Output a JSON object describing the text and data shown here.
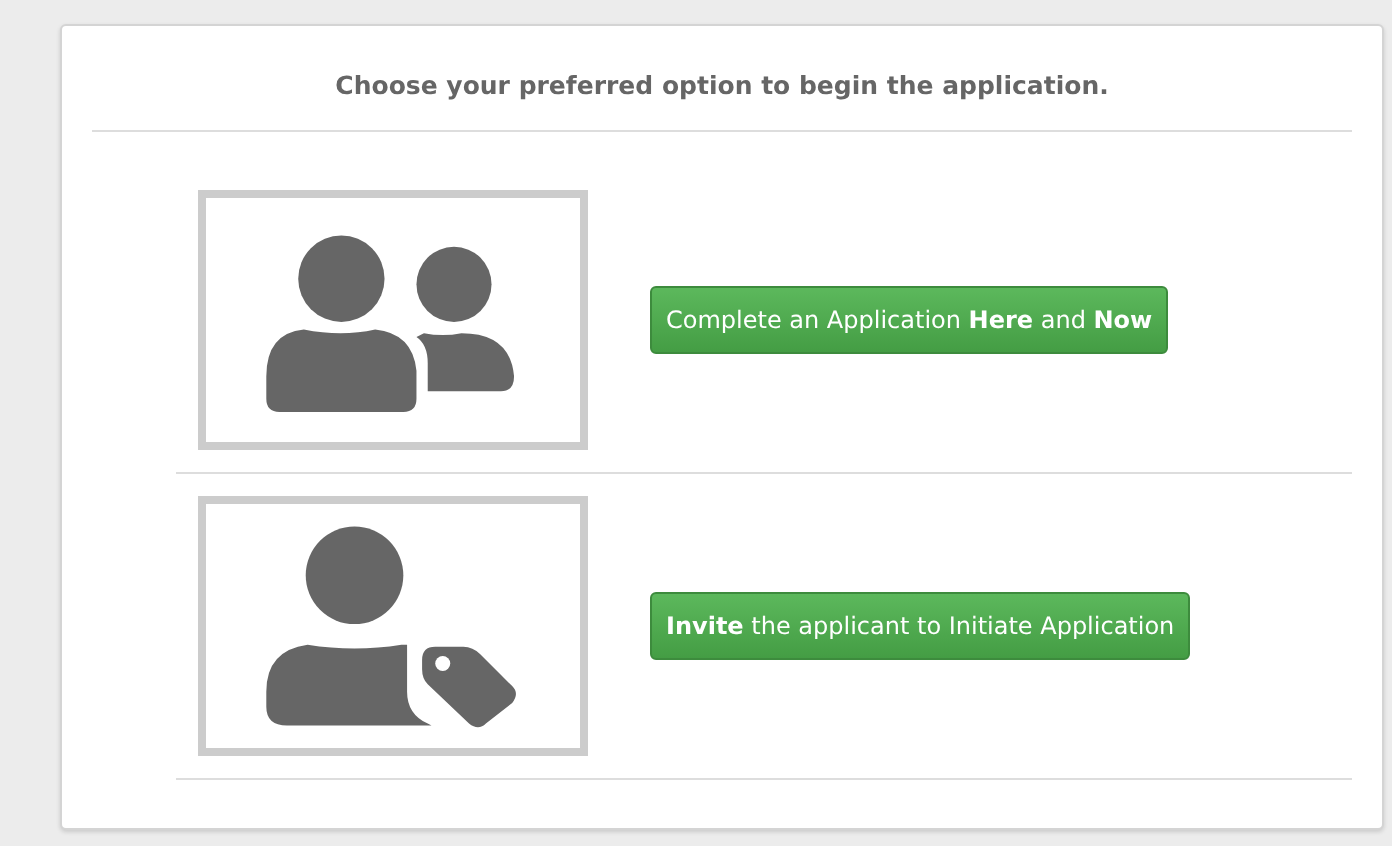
{
  "heading": "Choose your preferred option to begin the application.",
  "options": [
    {
      "kind": "group",
      "button": "Complete an Application **Here** and **Now**"
    },
    {
      "kind": "tagged",
      "button": "**Invite** the applicant to Initiate Application"
    }
  ]
}
